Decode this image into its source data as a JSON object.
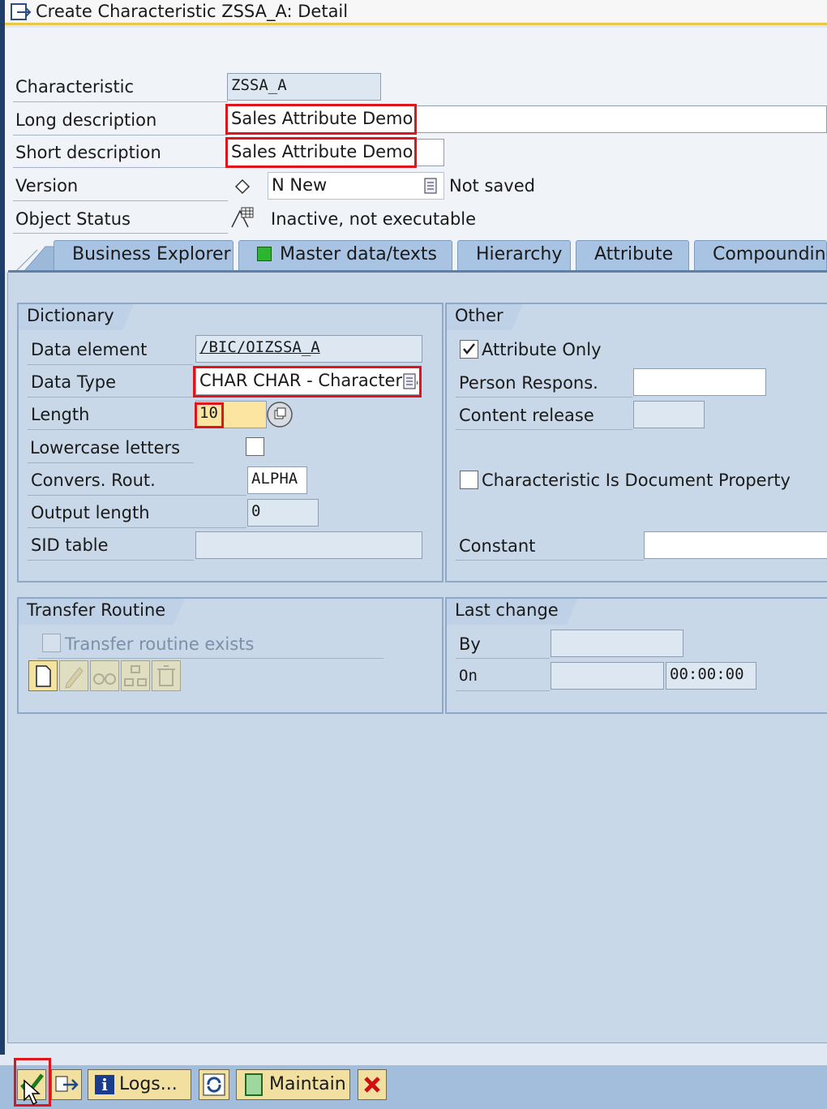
{
  "window": {
    "title": "Create Characteristic ZSSA_A: Detail"
  },
  "header": {
    "characteristic": {
      "label": "Characteristic",
      "value": "ZSSA_A"
    },
    "long_description": {
      "label": "Long description",
      "value": "Sales Attribute Demo"
    },
    "short_description": {
      "label": "Short description",
      "value": "Sales Attribute Demo"
    },
    "version": {
      "label": "Version",
      "value": "N New",
      "status": "Not saved"
    },
    "object_status": {
      "label": "Object Status",
      "value": "Inactive, not executable"
    }
  },
  "tabs": [
    {
      "label": "Business Explorer"
    },
    {
      "label": "Master data/texts"
    },
    {
      "label": "Hierarchy"
    },
    {
      "label": "Attribute"
    },
    {
      "label": "Compounding"
    }
  ],
  "dictionary": {
    "title": "Dictionary",
    "data_element": {
      "label": "Data element",
      "value": "/BIC/OIZSSA_A"
    },
    "data_type": {
      "label": "Data Type",
      "value": "CHAR CHAR - Character S"
    },
    "length": {
      "label": "Length",
      "value": "10"
    },
    "lowercase": {
      "label": "Lowercase letters",
      "checked": false
    },
    "convers_rout": {
      "label": "Convers. Rout.",
      "value": "ALPHA"
    },
    "output_length": {
      "label": "Output length",
      "value": "0"
    },
    "sid_table": {
      "label": "SID table",
      "value": ""
    }
  },
  "other": {
    "title": "Other",
    "attribute_only": {
      "label": "Attribute Only",
      "checked": true
    },
    "person_respons": {
      "label": "Person Respons.",
      "value": ""
    },
    "content_release": {
      "label": "Content release",
      "value": ""
    },
    "doc_property": {
      "label": "Characteristic Is Document Property",
      "checked": false
    },
    "constant": {
      "label": "Constant",
      "value": ""
    }
  },
  "transfer_routine": {
    "title": "Transfer Routine",
    "exists": {
      "label": "Transfer routine exists",
      "checked": false
    }
  },
  "last_change": {
    "title": "Last change",
    "by": {
      "label": "By",
      "value": ""
    },
    "on": {
      "label": "On",
      "date": "",
      "time": "00:00:00"
    }
  },
  "toolbar": {
    "logs_label": "Logs...",
    "maintain_label": "Maintain"
  },
  "colors": {
    "highlight": "#e0141b",
    "tab_active_dot": "#2db52d",
    "panel": "#c9d8e8"
  }
}
